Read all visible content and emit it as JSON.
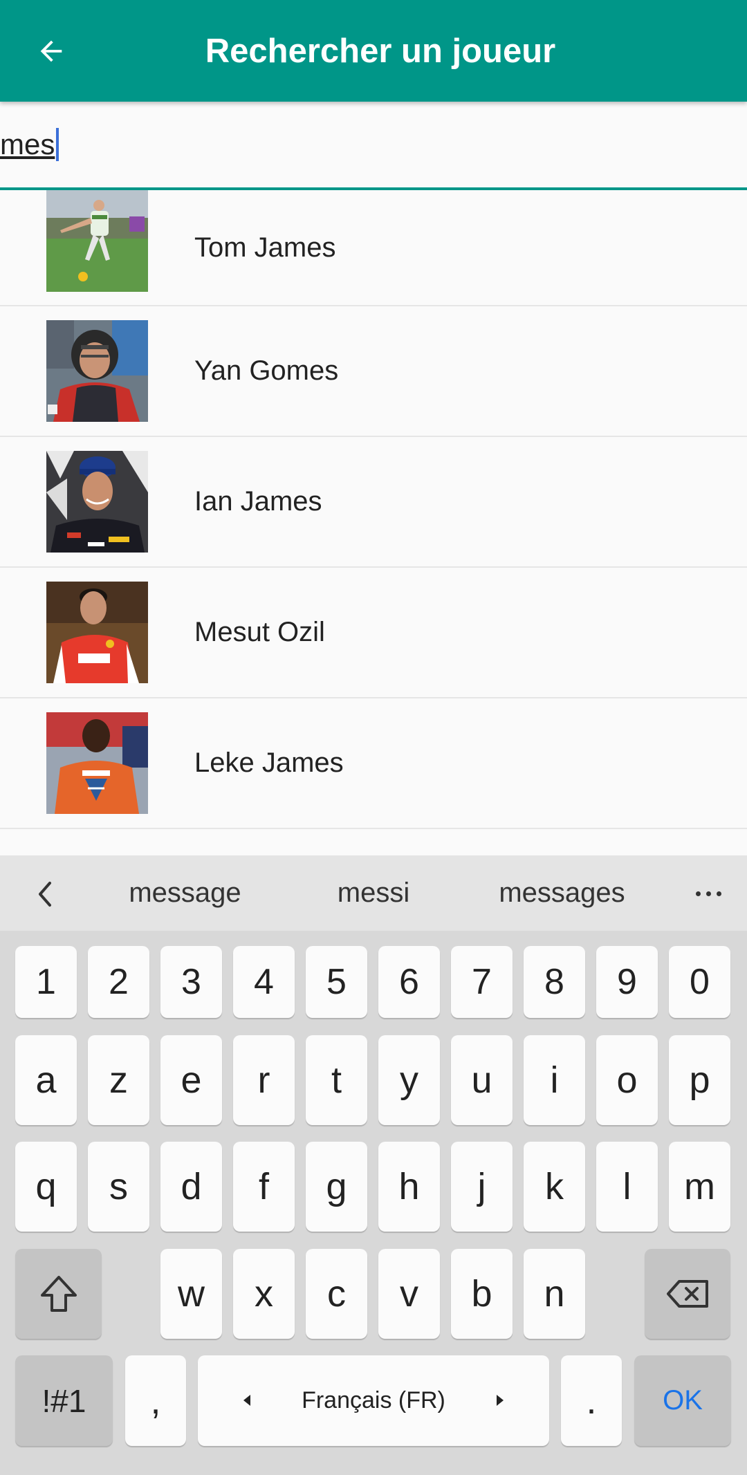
{
  "header": {
    "title": "Rechercher un joueur",
    "back_icon": "arrow-left-icon"
  },
  "search": {
    "value": "mes"
  },
  "colors": {
    "primary": "#009688",
    "caret": "#3b6fd8",
    "ok": "#1a73e8"
  },
  "players": [
    {
      "name": "Tom James"
    },
    {
      "name": "Yan Gomes"
    },
    {
      "name": "Ian James"
    },
    {
      "name": "Mesut Ozil"
    },
    {
      "name": "Leke James"
    }
  ],
  "keyboard": {
    "suggestions": [
      "message",
      "messi",
      "messages"
    ],
    "numbers": [
      "1",
      "2",
      "3",
      "4",
      "5",
      "6",
      "7",
      "8",
      "9",
      "0"
    ],
    "row1": [
      "a",
      "z",
      "e",
      "r",
      "t",
      "y",
      "u",
      "i",
      "o",
      "p"
    ],
    "row2": [
      "q",
      "s",
      "d",
      "f",
      "g",
      "h",
      "j",
      "k",
      "l",
      "m"
    ],
    "row3": [
      "w",
      "x",
      "c",
      "v",
      "b",
      "n"
    ],
    "symbols": "!#1",
    "comma": ",",
    "space": "Français (FR)",
    "period": ".",
    "ok": "OK"
  }
}
